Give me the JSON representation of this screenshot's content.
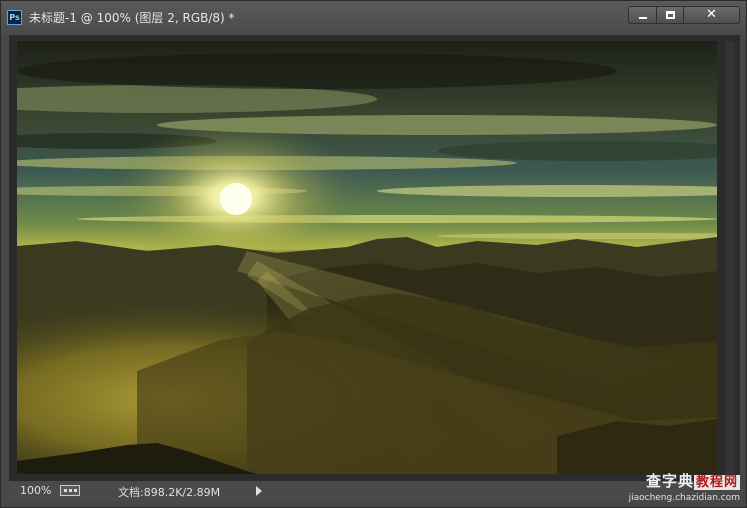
{
  "window": {
    "app_icon": "photoshop-icon",
    "app_icon_text": "Ps",
    "title": "未标题-1 @ 100% (图层 2, RGB/8) *",
    "minimize_icon": "minimize-icon",
    "maximize_icon": "maximize-icon",
    "close_icon": "close-icon",
    "close_glyph": "✕"
  },
  "canvas": {
    "content": "landscape",
    "colors": {
      "sky_top": "#1d2018",
      "sky_teal": "#3c5a52",
      "horizon_glow": "#d8d650",
      "fog": "#8a7c22",
      "ground": "#2a2710"
    }
  },
  "status": {
    "zoom": "100%",
    "doc_info": "文档:898.2K/2.89M",
    "menu_arrow_icon": "triangle-right-icon"
  },
  "watermark": {
    "main": "查字典",
    "sub": "教程网",
    "url": "jiaocheng.chazidian.com"
  }
}
